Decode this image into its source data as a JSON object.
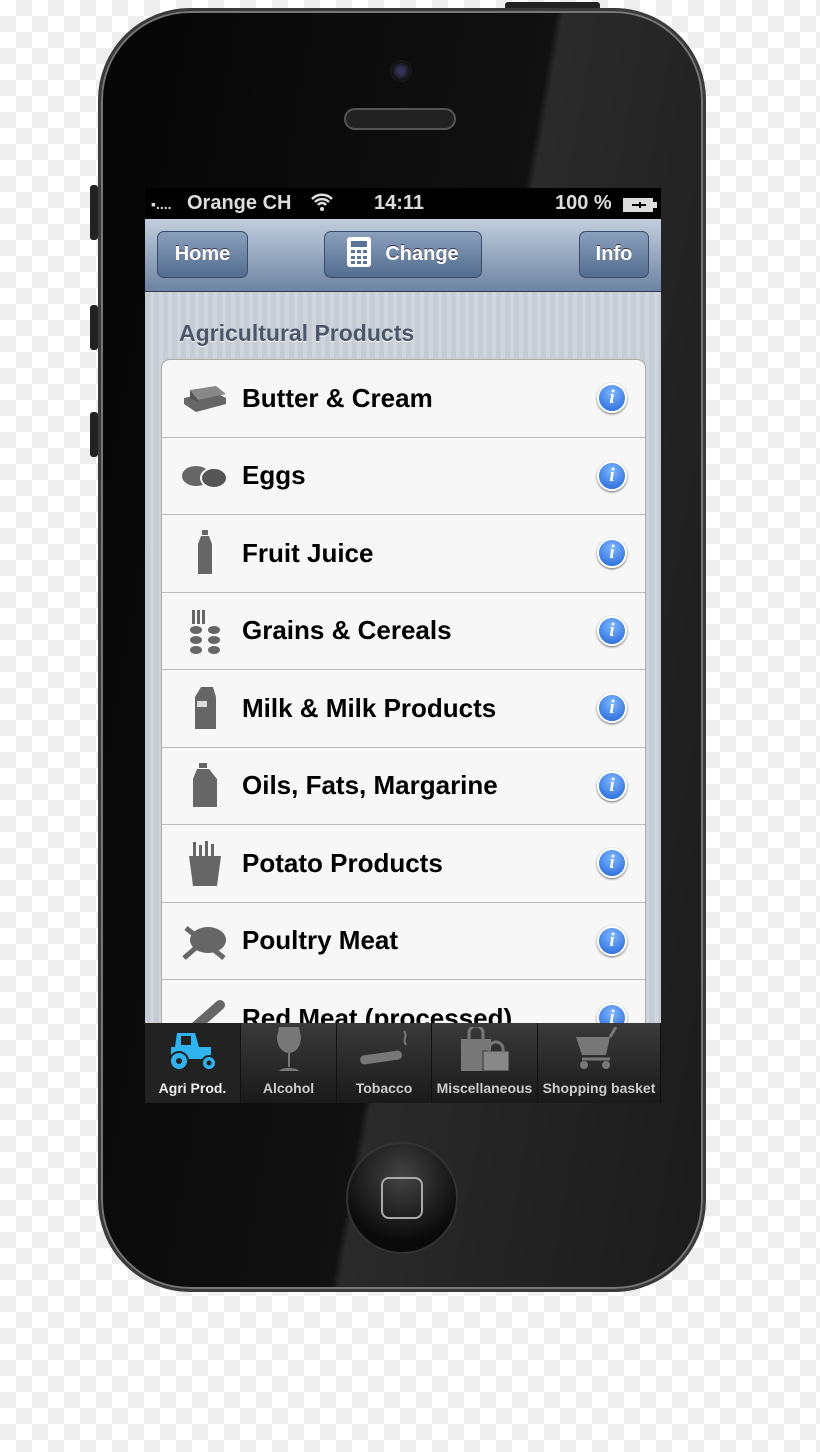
{
  "status": {
    "carrier": "Orange CH",
    "time": "14:11",
    "battery": "100 %"
  },
  "nav": {
    "home": "Home",
    "change": "Change",
    "info": "Info"
  },
  "section_title": "Agricultural Products",
  "items": [
    {
      "label": "Butter & Cream",
      "icon": "butter-icon"
    },
    {
      "label": "Eggs",
      "icon": "eggs-icon"
    },
    {
      "label": "Fruit Juice",
      "icon": "bottle-icon"
    },
    {
      "label": "Grains & Cereals",
      "icon": "grain-icon"
    },
    {
      "label": "Milk & Milk Products",
      "icon": "milk-carton-icon"
    },
    {
      "label": "Oils, Fats, Margarine",
      "icon": "oil-jug-icon"
    },
    {
      "label": "Potato Products",
      "icon": "fries-icon"
    },
    {
      "label": "Poultry Meat",
      "icon": "chicken-icon"
    },
    {
      "label": "Red Meat (processed)",
      "icon": "sausage-icon"
    }
  ],
  "tabs": [
    {
      "label": "Agri Prod.",
      "icon": "tractor-icon",
      "selected": true
    },
    {
      "label": "Alcohol",
      "icon": "wine-glass-icon"
    },
    {
      "label": "Tobacco",
      "icon": "cigar-icon"
    },
    {
      "label": "Miscellaneous",
      "icon": "shopping-bags-icon"
    },
    {
      "label": "Shopping basket",
      "icon": "cart-icon"
    }
  ],
  "colors": {
    "accent": "#2fb4ef",
    "nav": "#6d83a1",
    "info": "#1f63d6"
  }
}
